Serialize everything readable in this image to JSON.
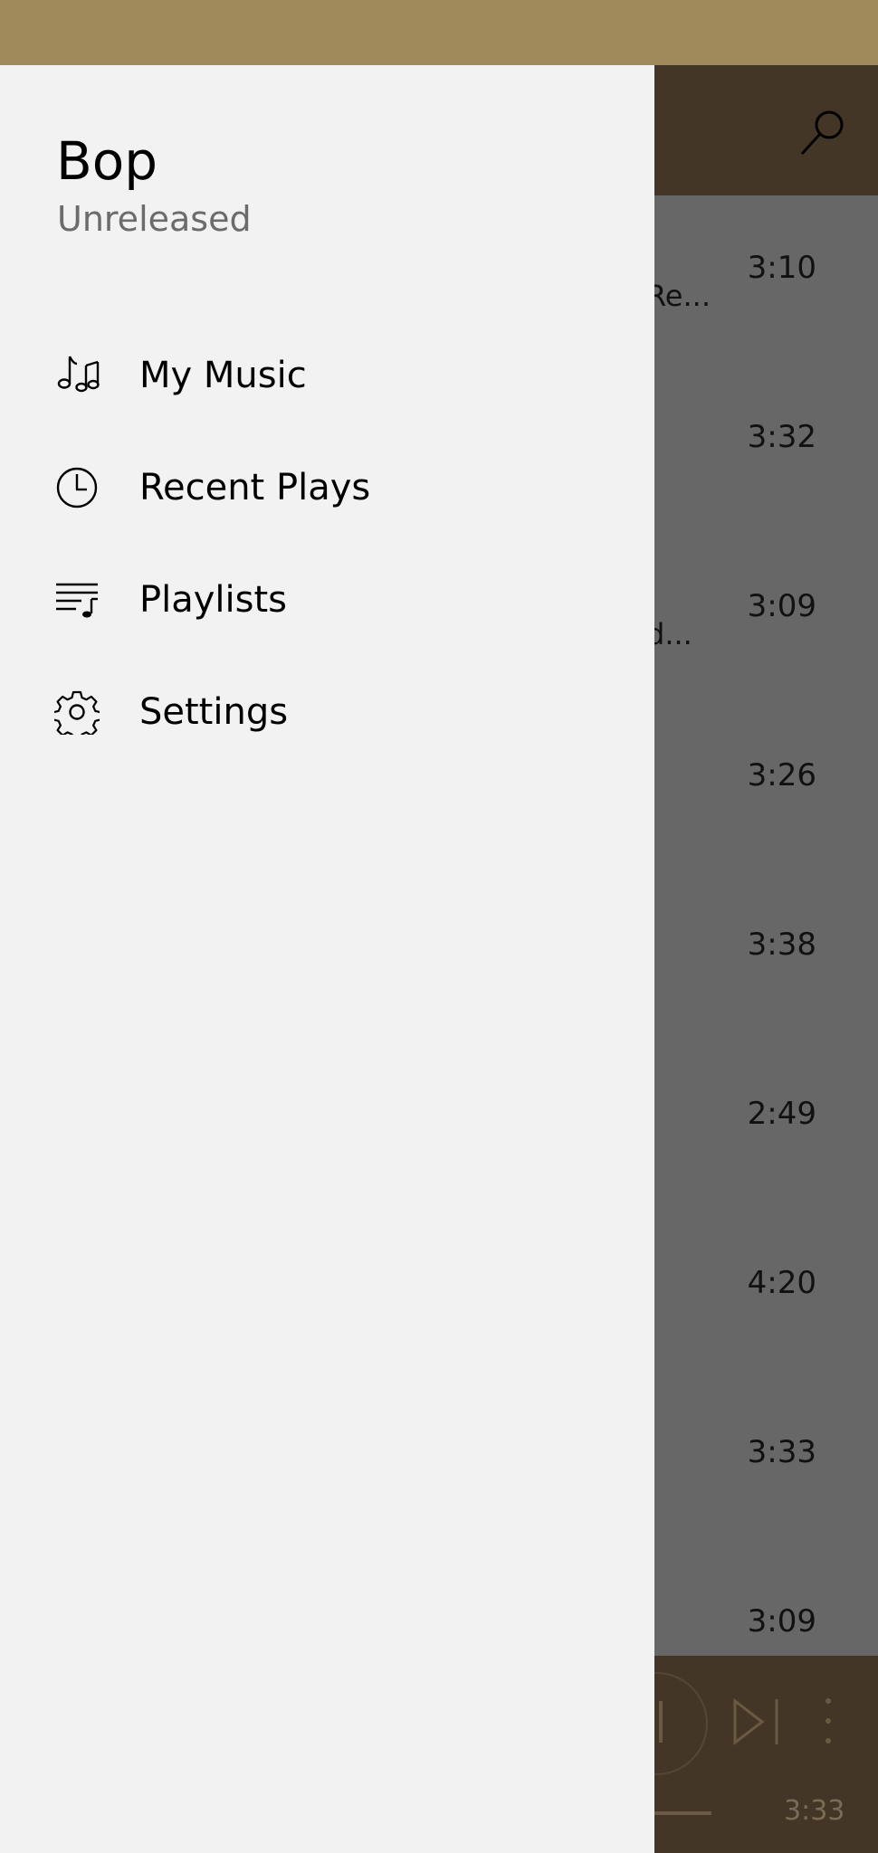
{
  "drawer": {
    "app_title": "Bop",
    "app_subtitle": "Unreleased",
    "nav_items": [
      {
        "label": "My Music",
        "icon": "music-note-icon"
      },
      {
        "label": "Recent Plays",
        "icon": "clock-icon"
      },
      {
        "label": "Playlists",
        "icon": "playlist-icon"
      },
      {
        "label": "Settings",
        "icon": "gear-icon"
      }
    ]
  },
  "header": {
    "search_icon": "search-icon"
  },
  "songs": [
    {
      "duration": "3:10",
      "artist_fragment": "Re..."
    },
    {
      "duration": "3:32",
      "artist_fragment": ""
    },
    {
      "duration": "3:09",
      "artist_fragment": "d..."
    },
    {
      "duration": "3:26",
      "artist_fragment": ""
    },
    {
      "duration": "3:38",
      "artist_fragment": ""
    },
    {
      "duration": "2:49",
      "artist_fragment": ""
    },
    {
      "duration": "4:20",
      "artist_fragment": ""
    },
    {
      "duration": "3:33",
      "artist_fragment": ""
    },
    {
      "duration": "3:09",
      "artist_fragment": ""
    }
  ],
  "player": {
    "time": "3:33",
    "next_icon": "skip-next-icon",
    "more_icon": "more-vertical-icon"
  },
  "colors": {
    "status_bar": "#a0895a",
    "header": "#433626",
    "drawer_bg": "#f2f2f2",
    "overlay": "#676767"
  }
}
